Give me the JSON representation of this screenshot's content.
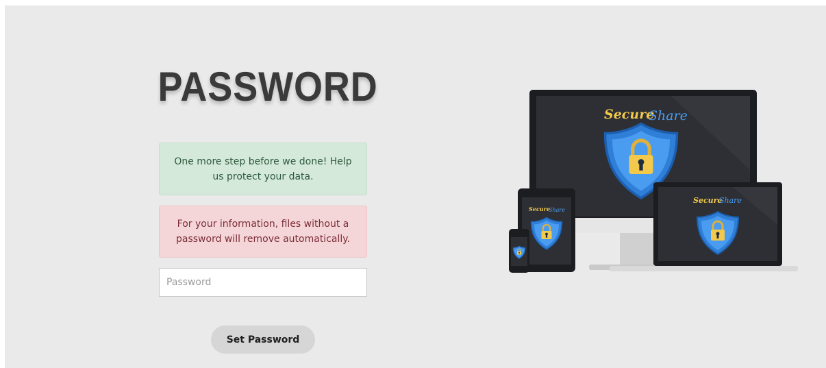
{
  "page": {
    "title": "PASSWORD"
  },
  "alerts": {
    "success": "One more step before we done! Help us protect your data.",
    "danger": "For your information, files without a password will remove automatically."
  },
  "form": {
    "password_placeholder": "Password",
    "password_value": "",
    "submit_label": "Set Password"
  },
  "illustration": {
    "brand_word_1": "Secure",
    "brand_word_2": "Share",
    "icons": [
      "shield-icon",
      "padlock-icon"
    ]
  },
  "colors": {
    "background": "#eaeaea",
    "success_bg": "#d5e9db",
    "danger_bg": "#f4d6d9",
    "button_bg": "#d6d6d6",
    "shield_blue": "#3b8fe6",
    "lock_yellow": "#f2c94c"
  }
}
